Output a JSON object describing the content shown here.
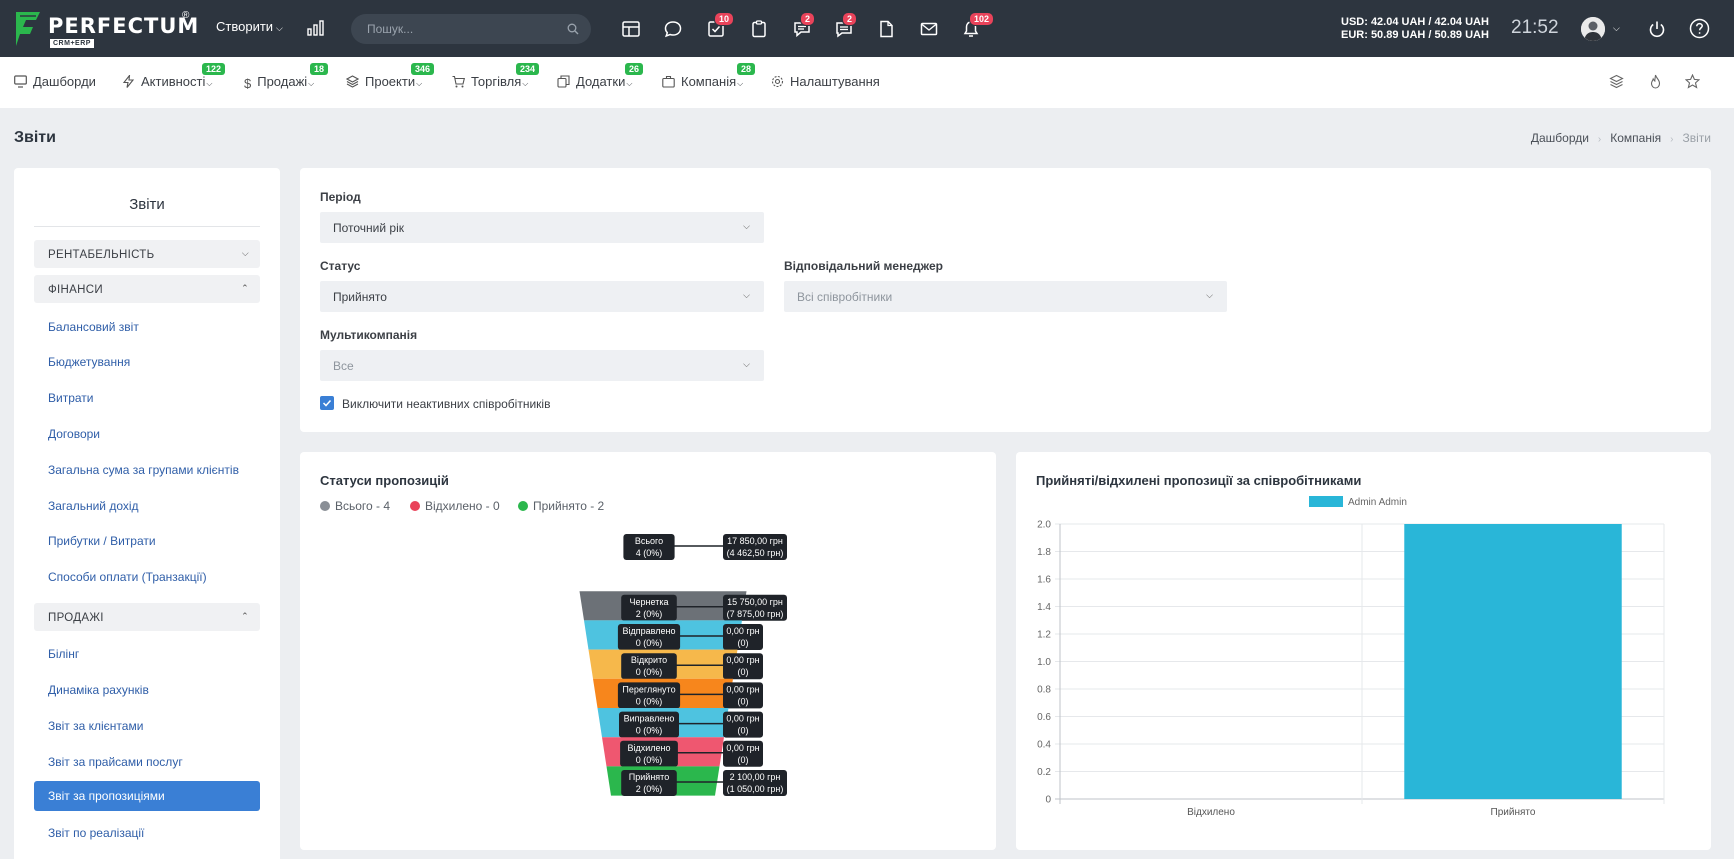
{
  "topbar": {
    "logo_text": "PERFECTUM",
    "logo_reg": "®",
    "logo_sub": "CRM+ERP",
    "create_label": "Створити",
    "search_placeholder": "Пошук...",
    "badges": {
      "tasks": "10",
      "chat": "2",
      "messages": "2",
      "notifications": "102"
    },
    "currency_usd": "USD: 42.04 UAH / 42.04 UAH",
    "currency_eur": "EUR: 50.89 UAH / 50.89 UAH",
    "time": "21:52"
  },
  "nav": [
    {
      "label": "Дашборди",
      "badge": ""
    },
    {
      "label": "Активності",
      "badge": "122"
    },
    {
      "label": "Продажі",
      "badge": "18"
    },
    {
      "label": "Проекти",
      "badge": "346"
    },
    {
      "label": "Торгівля",
      "badge": "234"
    },
    {
      "label": "Додатки",
      "badge": "26"
    },
    {
      "label": "Компанія",
      "badge": "28"
    },
    {
      "label": "Налаштування",
      "badge": ""
    }
  ],
  "page": {
    "title": "Звіти",
    "breadcrumb": [
      "Дашборди",
      "Компанія",
      "Звіти"
    ]
  },
  "sidebar": {
    "title": "Звіти",
    "sections": [
      {
        "label": "РЕНТАБЕЛЬНІСТЬ"
      },
      {
        "label": "ФІНАНСИ"
      },
      {
        "label": "ПРОДАЖІ"
      }
    ],
    "finance_links": [
      "Балансовий звіт",
      "Бюджетування",
      "Витрати",
      "Договори",
      "Загальна сума за групами клієнтів",
      "Загальний дохід",
      "Прибутки / Витрати",
      "Способи оплати (Транзакції)"
    ],
    "sales_links": [
      "Білінг",
      "Динаміка рахунків",
      "Звіт за клієнтами",
      "Звіт за прайсами послуг",
      "Звіт за пропозиціями",
      "Звіт по реалізації"
    ]
  },
  "filters": {
    "period_label": "Період",
    "period_value": "Поточний рік",
    "status_label": "Статус",
    "status_value": "Прийнято",
    "manager_label": "Відповідальний менеджер",
    "manager_value": "Всі співробітники",
    "multicompany_label": "Мультикомпанія",
    "multicompany_value": "Все",
    "exclude_inactive_label": "Виключити неактивних співробітників"
  },
  "funnel_card": {
    "title": "Статуси пропозицій",
    "legend": [
      {
        "label": "Всього - 4",
        "color": "#8a8f96"
      },
      {
        "label": "Відхилено - 0",
        "color": "#e9435a"
      },
      {
        "label": "Прийнято - 2",
        "color": "#2bb74d"
      }
    ]
  },
  "bar_card": {
    "title": "Прийняті/відхилені пропозиції за співробітниками"
  },
  "chart_data": [
    {
      "type": "funnel",
      "stages": [
        {
          "name": "Всього",
          "count_label": "4 (0%)",
          "amount": "17 850,00 грн",
          "amount_sub": "(4 462,50 грн)",
          "color": "#ffffff"
        },
        {
          "name": "Чернетка",
          "count_label": "2 (0%)",
          "amount": "15 750,00 грн",
          "amount_sub": "(7 875,00 грн)",
          "color": "#6c7177"
        },
        {
          "name": "Відправлено",
          "count_label": "0 (0%)",
          "amount": "0,00 грн",
          "amount_sub": "(0)",
          "color": "#4ec3e0"
        },
        {
          "name": "Відкрито",
          "count_label": "0 (0%)",
          "amount": "0,00 грн",
          "amount_sub": "(0)",
          "color": "#f6b84b"
        },
        {
          "name": "Переглянуто",
          "count_label": "0 (0%)",
          "amount": "0,00 грн",
          "amount_sub": "(0)",
          "color": "#f7861c"
        },
        {
          "name": "Виправлено",
          "count_label": "0 (0%)",
          "amount": "0,00 грн",
          "amount_sub": "(0)",
          "color": "#4ec3e0"
        },
        {
          "name": "Відхилено",
          "count_label": "0 (0%)",
          "amount": "0,00 грн",
          "amount_sub": "(0)",
          "color": "#ef5770"
        },
        {
          "name": "Прийнято",
          "count_label": "2 (0%)",
          "amount": "2 100,00 грн",
          "amount_sub": "(1 050,00 грн)",
          "color": "#2bb74d"
        }
      ]
    },
    {
      "type": "bar",
      "categories": [
        "Відхилено",
        "Прийнято"
      ],
      "series": [
        {
          "name": "Admin Admin",
          "values": [
            0,
            2
          ],
          "color": "#29b6d8"
        }
      ],
      "ylim": [
        0,
        2.0
      ],
      "yticks": [
        "0",
        "0.2",
        "0.4",
        "0.6",
        "0.8",
        "1.0",
        "1.2",
        "1.4",
        "1.6",
        "1.8",
        "2.0"
      ],
      "grid": true,
      "legend": "top-center"
    }
  ]
}
